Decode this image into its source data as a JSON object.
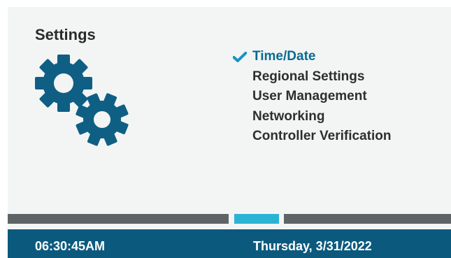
{
  "screen": {
    "title": "Settings",
    "icon": "gears-icon"
  },
  "menu": {
    "items": [
      {
        "label": "Time/Date",
        "selected": true
      },
      {
        "label": "Regional Settings",
        "selected": false
      },
      {
        "label": "User Management",
        "selected": false
      },
      {
        "label": "Networking",
        "selected": false
      },
      {
        "label": "Controller Verification",
        "selected": false
      }
    ]
  },
  "page_indicator": {
    "active_index": 1,
    "count": 3
  },
  "status_bar": {
    "time": "06:30:45AM",
    "date": "Thursday, 3/31/2022"
  },
  "colors": {
    "accent": "#0b5a7e",
    "selected_text": "#0a6b8f",
    "indicator_active": "#2bb3d3",
    "indicator_inactive": "#5e6466",
    "check": "#1793c7",
    "gear": "#0f5f84"
  }
}
